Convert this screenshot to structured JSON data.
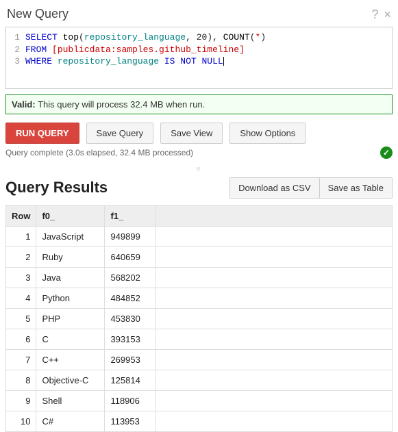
{
  "header": {
    "title": "New Query",
    "help_icon": "?",
    "close_icon": "×"
  },
  "editor": {
    "lines": [
      {
        "num": "1",
        "kw1": "SELECT",
        "fn": "top",
        "arg": "repository_language",
        "comma": ", ",
        "lit": "20",
        "close": "), ",
        "fn2": "COUNT",
        "star": "*"
      },
      {
        "num": "2",
        "kw1": "FROM",
        "bracket": "[publicdata:samples.github_timeline]"
      },
      {
        "num": "3",
        "kw1": "WHERE",
        "arg": "repository_language",
        "kw2": "IS NOT NULL"
      }
    ]
  },
  "validation": {
    "label": "Valid:",
    "text": " This query will process 32.4 MB when run."
  },
  "buttons": {
    "run": "RUN QUERY",
    "save_query": "Save Query",
    "save_view": "Save View",
    "show_options": "Show Options"
  },
  "status": {
    "text": "Query complete (3.0s elapsed, 32.4 MB processed)",
    "ok": "✓"
  },
  "results": {
    "title": "Query Results",
    "download_csv": "Download as CSV",
    "save_table": "Save as Table",
    "columns": {
      "row": "Row",
      "f0": "f0_",
      "f1": "f1_"
    },
    "rows": [
      {
        "row": "1",
        "f0": "JavaScript",
        "f1": "949899"
      },
      {
        "row": "2",
        "f0": "Ruby",
        "f1": "640659"
      },
      {
        "row": "3",
        "f0": "Java",
        "f1": "568202"
      },
      {
        "row": "4",
        "f0": "Python",
        "f1": "484852"
      },
      {
        "row": "5",
        "f0": "PHP",
        "f1": "453830"
      },
      {
        "row": "6",
        "f0": "C",
        "f1": "393153"
      },
      {
        "row": "7",
        "f0": "C++",
        "f1": "269953"
      },
      {
        "row": "8",
        "f0": "Objective-C",
        "f1": "125814"
      },
      {
        "row": "9",
        "f0": "Shell",
        "f1": "118906"
      },
      {
        "row": "10",
        "f0": "C#",
        "f1": "113953"
      }
    ]
  },
  "chart_data": {
    "type": "table",
    "title": "Query Results",
    "columns": [
      "Row",
      "f0_",
      "f1_"
    ],
    "rows": [
      [
        1,
        "JavaScript",
        949899
      ],
      [
        2,
        "Ruby",
        640659
      ],
      [
        3,
        "Java",
        568202
      ],
      [
        4,
        "Python",
        484852
      ],
      [
        5,
        "PHP",
        453830
      ],
      [
        6,
        "C",
        393153
      ],
      [
        7,
        "C++",
        269953
      ],
      [
        8,
        "Objective-C",
        125814
      ],
      [
        9,
        "Shell",
        118906
      ],
      [
        10,
        "C#",
        113953
      ]
    ]
  }
}
